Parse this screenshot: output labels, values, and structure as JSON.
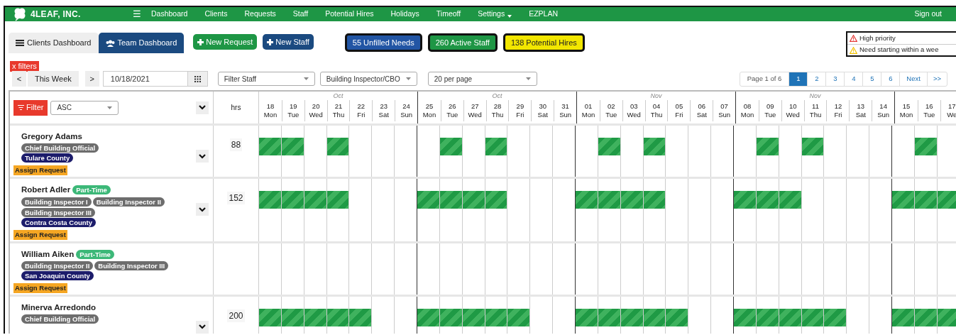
{
  "nav": {
    "brand": "4LEAF, INC.",
    "menu_icon": "☰",
    "links": [
      {
        "label": "Dashboard",
        "dropdown": false
      },
      {
        "label": "Clients",
        "dropdown": false
      },
      {
        "label": "Requests",
        "dropdown": false
      },
      {
        "label": "Staff",
        "dropdown": false
      },
      {
        "label": "Potential Hires",
        "dropdown": false
      },
      {
        "label": "Holidays",
        "dropdown": false
      },
      {
        "label": "Timeoff",
        "dropdown": false
      },
      {
        "label": "Settings",
        "dropdown": true
      },
      {
        "label": "EZPLAN",
        "dropdown": false
      }
    ],
    "sign_out": "Sign out"
  },
  "tabs": [
    {
      "label": "Clients Dashboard",
      "selected": false
    },
    {
      "label": "Team Dashboard",
      "selected": true
    }
  ],
  "actions": [
    {
      "label": "New Request",
      "kind": "green"
    },
    {
      "label": "New Staff",
      "kind": "navy"
    }
  ],
  "stats": [
    {
      "label": "55 Unfilled Needs",
      "color": "#2255a4"
    },
    {
      "label": "260 Active Staff",
      "color": "#1e9645"
    },
    {
      "label": "138 Potential Hires",
      "color": "#f2e600"
    }
  ],
  "legend": [
    {
      "label": "High priority",
      "color": "#e53935"
    },
    {
      "label": "Need starting within a wee",
      "color": "#f2c200"
    }
  ],
  "clear_filters": "x filters",
  "week_nav": {
    "prev": "<",
    "label": "This Week",
    "next": ">",
    "date": "10/18/2021"
  },
  "selects": [
    "Filter Staff",
    "Building Inspector/CBO",
    "20 per page"
  ],
  "pagination": {
    "info": "Page 1 of 6",
    "pages": [
      {
        "label": "1",
        "selected": true
      },
      {
        "label": "2",
        "selected": false
      },
      {
        "label": "3",
        "selected": false
      },
      {
        "label": "4",
        "selected": false
      },
      {
        "label": "5",
        "selected": false
      },
      {
        "label": "6",
        "selected": false
      }
    ],
    "next": "Next",
    "last": ">>"
  },
  "grid": {
    "filter_button": "Filter",
    "sort": "ASC",
    "hrs_heading": "hrs",
    "weeks": [
      {
        "month": "Oct",
        "days": [
          {
            "date": "18",
            "day": "Mon"
          },
          {
            "date": "19",
            "day": "Tue"
          },
          {
            "date": "20",
            "day": "Wed"
          },
          {
            "date": "21",
            "day": "Thu"
          },
          {
            "date": "22",
            "day": "Fri"
          },
          {
            "date": "23",
            "day": "Sat"
          },
          {
            "date": "24",
            "day": "Sun"
          }
        ]
      },
      {
        "month": "Oct",
        "days": [
          {
            "date": "25",
            "day": "Mon"
          },
          {
            "date": "26",
            "day": "Tue"
          },
          {
            "date": "27",
            "day": "Wed"
          },
          {
            "date": "28",
            "day": "Thu"
          },
          {
            "date": "29",
            "day": "Fri"
          },
          {
            "date": "30",
            "day": "Sat"
          },
          {
            "date": "31",
            "day": "Sun"
          }
        ]
      },
      {
        "month": "Nov",
        "days": [
          {
            "date": "01",
            "day": "Mon"
          },
          {
            "date": "02",
            "day": "Tue"
          },
          {
            "date": "03",
            "day": "Wed"
          },
          {
            "date": "04",
            "day": "Thu"
          },
          {
            "date": "05",
            "day": "Fri"
          },
          {
            "date": "06",
            "day": "Sat"
          },
          {
            "date": "07",
            "day": "Sun"
          }
        ]
      },
      {
        "month": "Nov",
        "days": [
          {
            "date": "08",
            "day": "Mon"
          },
          {
            "date": "09",
            "day": "Tue"
          },
          {
            "date": "10",
            "day": "Wed"
          },
          {
            "date": "11",
            "day": "Thu"
          },
          {
            "date": "12",
            "day": "Fri"
          },
          {
            "date": "13",
            "day": "Sat"
          },
          {
            "date": "14",
            "day": "Sun"
          }
        ]
      },
      {
        "days": [
          {
            "date": "15",
            "day": "Mon"
          },
          {
            "date": "16",
            "day": "Tue"
          },
          {
            "date": "17",
            "day": "We"
          }
        ]
      }
    ],
    "staff": [
      {
        "name": "Gregory Adams",
        "roles": [
          "Chief Building Official"
        ],
        "county": "Tulare County",
        "assign": "Assign Request",
        "expand_button": true,
        "hrs": "88",
        "scheduled": [
          true,
          true,
          false,
          true,
          false,
          false,
          false,
          false,
          true,
          false,
          true,
          false,
          false,
          false,
          false,
          true,
          false,
          true,
          false,
          false,
          false,
          false,
          true,
          false,
          true,
          false,
          false,
          false,
          false,
          true,
          false
        ]
      },
      {
        "name": "Robert Adler",
        "part_time": "Part-Time",
        "roles": [
          "Building Inspector I",
          "Building Inspector II",
          "Building Inspector III"
        ],
        "county": "Contra Costa County",
        "assign": "Assign Request",
        "expand_button": true,
        "hrs": "152",
        "scheduled": [
          true,
          true,
          true,
          true,
          false,
          false,
          false,
          true,
          true,
          true,
          true,
          false,
          false,
          false,
          true,
          true,
          true,
          true,
          false,
          false,
          false,
          true,
          true,
          true,
          false,
          false,
          false,
          false,
          true,
          true,
          true
        ]
      },
      {
        "name": "William Aiken",
        "part_time": "Part-Time",
        "roles": [
          "Building Inspector II",
          "Building Inspector III"
        ],
        "county": "San Joaquin County",
        "assign": "Assign Request",
        "expand_button": false,
        "scheduled": [
          false,
          false,
          false,
          false,
          false,
          false,
          false,
          false,
          false,
          false,
          false,
          false,
          false,
          false,
          false,
          false,
          false,
          false,
          false,
          false,
          false,
          false,
          false,
          false,
          false,
          false,
          false,
          false,
          false,
          false,
          false
        ]
      },
      {
        "name": "Minerva Arredondo",
        "roles": [
          "Chief Building Official"
        ],
        "expand_button": true,
        "hrs": "200",
        "scheduled": [
          true,
          true,
          true,
          true,
          true,
          false,
          false,
          true,
          true,
          true,
          true,
          true,
          false,
          false,
          true,
          true,
          true,
          true,
          true,
          false,
          false,
          true,
          true,
          true,
          true,
          true,
          false,
          false,
          true,
          true,
          true
        ]
      }
    ]
  }
}
